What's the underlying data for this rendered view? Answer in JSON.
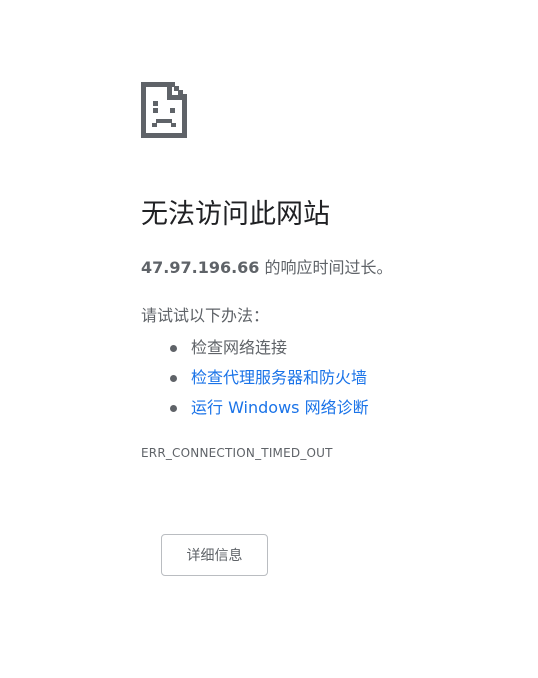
{
  "error_page": {
    "icon": "sad-page-icon",
    "title": "无法访问此网站",
    "host": "47.97.196.66",
    "message_suffix": " 的响应时间过长。",
    "try_label": "请试试以下办法：",
    "suggestions": [
      {
        "text": "检查网络连接",
        "is_link": false
      },
      {
        "text": "检查代理服务器和防火墙",
        "is_link": true
      },
      {
        "text": "运行 Windows 网络诊断",
        "is_link": true
      }
    ],
    "error_code": "ERR_CONNECTION_TIMED_OUT",
    "details_button": "详细信息"
  },
  "colors": {
    "title": "#202124",
    "body_text": "#5f6368",
    "link": "#1a73e8",
    "button_border": "#babdc1",
    "icon": "#5f6368"
  }
}
